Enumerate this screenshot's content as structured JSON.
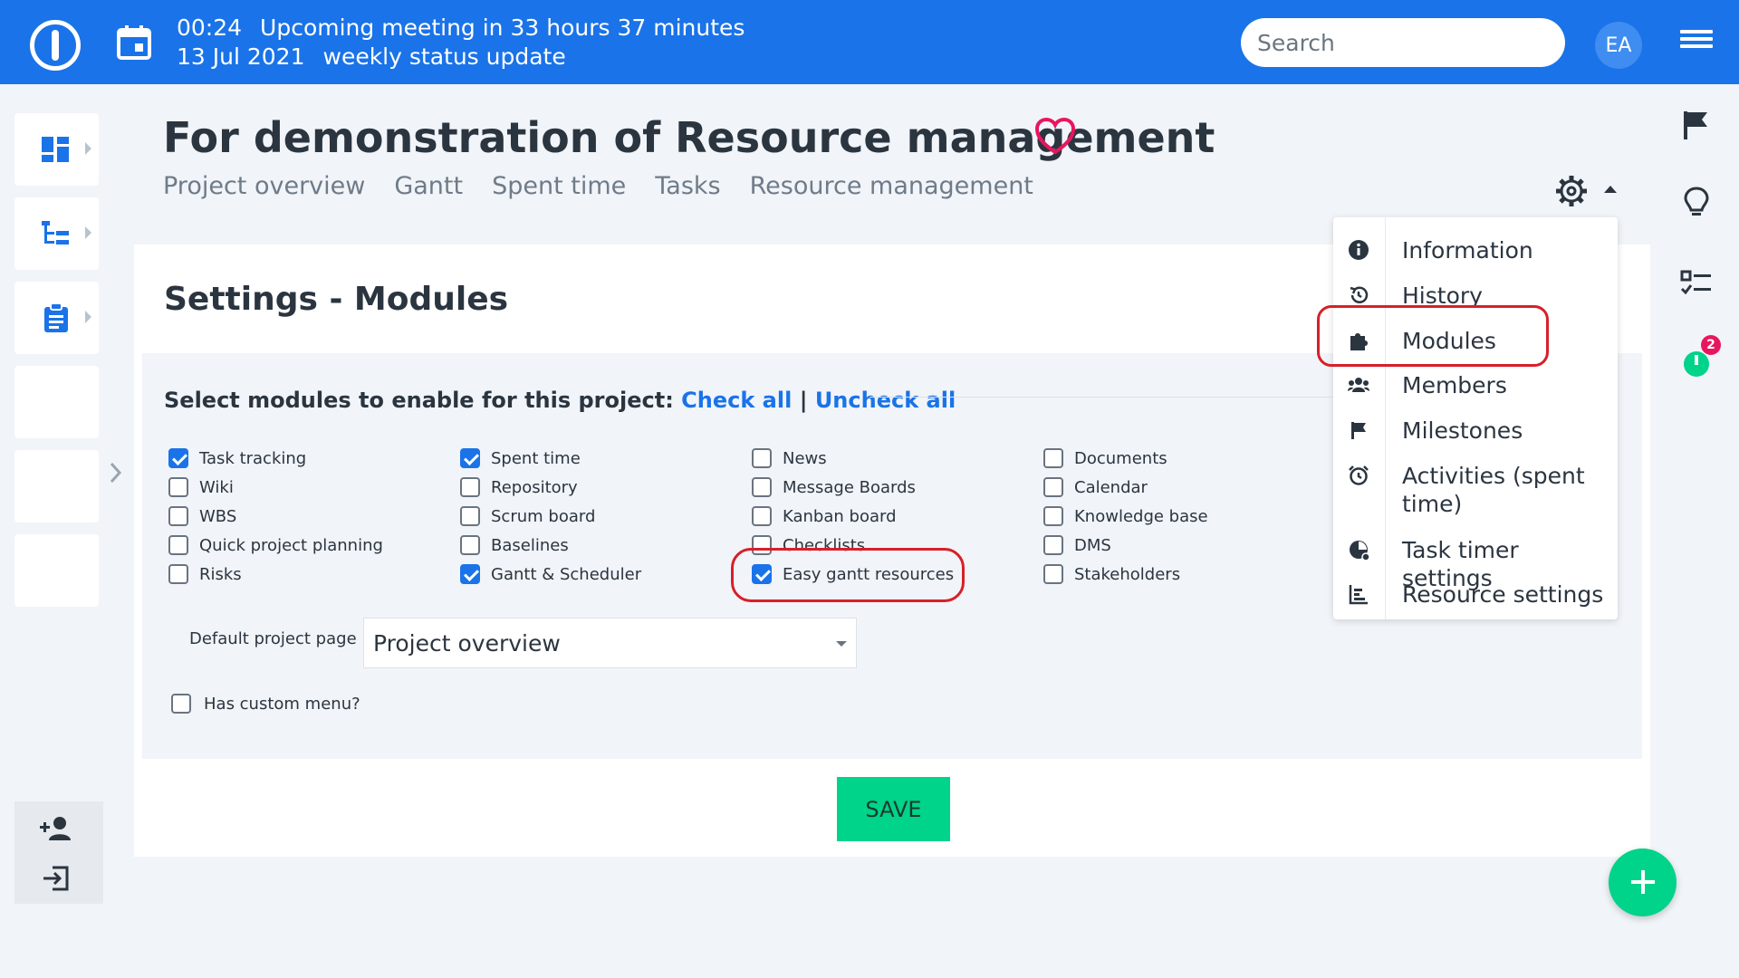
{
  "topbar": {
    "meeting_time": "00:24",
    "meeting_text": "Upcoming meeting in 33 hours 37 minutes",
    "meeting_date": "13 Jul 2021",
    "meeting_title": "weekly status update",
    "search_placeholder": "Search",
    "avatar_initials": "EA"
  },
  "header": {
    "title": "For demonstration of Resource management",
    "nav": [
      "Project overview",
      "Gantt",
      "Spent time",
      "Tasks",
      "Resource management"
    ]
  },
  "settings": {
    "title": "Settings - Modules",
    "select_label": "Select modules to enable for this project:",
    "check_all": "Check all",
    "separator": "|",
    "uncheck_all": "Uncheck all",
    "modules": [
      {
        "label": "Task tracking",
        "checked": true
      },
      {
        "label": "Wiki",
        "checked": false
      },
      {
        "label": "WBS",
        "checked": false
      },
      {
        "label": "Quick project planning",
        "checked": false
      },
      {
        "label": "Risks",
        "checked": false
      },
      {
        "label": "Spent time",
        "checked": true
      },
      {
        "label": "Repository",
        "checked": false
      },
      {
        "label": "Scrum board",
        "checked": false
      },
      {
        "label": "Baselines",
        "checked": false
      },
      {
        "label": "Gantt & Scheduler",
        "checked": true
      },
      {
        "label": "News",
        "checked": false
      },
      {
        "label": "Message Boards",
        "checked": false
      },
      {
        "label": "Kanban board",
        "checked": false
      },
      {
        "label": "Checklists",
        "checked": false
      },
      {
        "label": "Easy gantt resources",
        "checked": true
      },
      {
        "label": "Documents",
        "checked": false
      },
      {
        "label": "Calendar",
        "checked": false
      },
      {
        "label": "Knowledge base",
        "checked": false
      },
      {
        "label": "DMS",
        "checked": false
      },
      {
        "label": "Stakeholders",
        "checked": false
      }
    ],
    "default_page_label": "Default project page",
    "default_page_value": "Project overview",
    "custom_menu_label": "Has custom menu?",
    "save_label": "SAVE"
  },
  "menu": {
    "items": [
      {
        "label": "Information",
        "icon": "info-icon"
      },
      {
        "label": "History",
        "icon": "history-icon"
      },
      {
        "label": "Modules",
        "icon": "puzzle-icon"
      },
      {
        "label": "Members",
        "icon": "members-icon"
      },
      {
        "label": "Milestones",
        "icon": "flag-icon"
      },
      {
        "label": "Activities (spent time)",
        "icon": "alarm-icon"
      },
      {
        "label": "Task timer settings",
        "icon": "timer-icon"
      },
      {
        "label": "Resource settings",
        "icon": "resource-icon"
      }
    ]
  },
  "right_sidebar": {
    "timer_badge": "2"
  },
  "colors": {
    "brand": "#1a73e8",
    "accent_green": "#00d38a",
    "annotation_red": "#d6202a",
    "heart": "#e8175d"
  }
}
